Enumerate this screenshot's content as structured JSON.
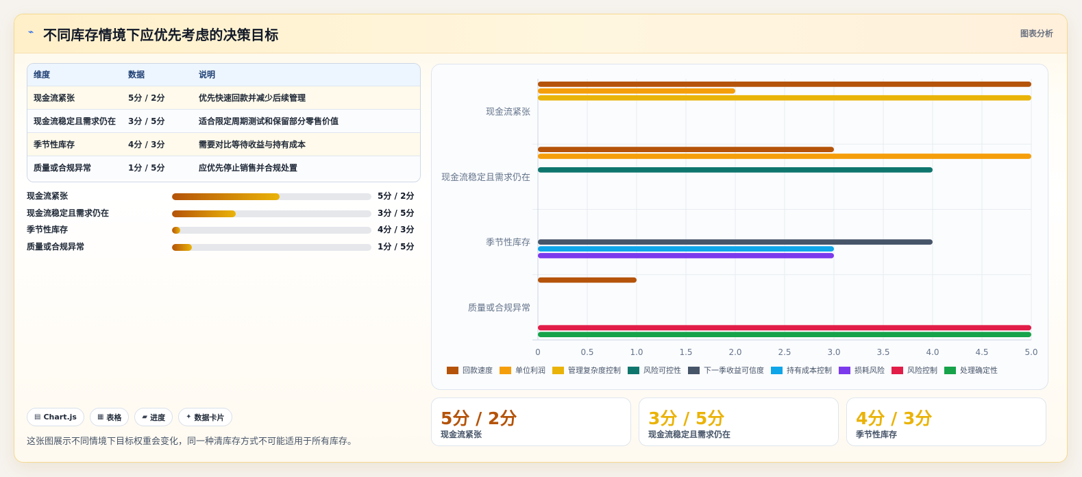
{
  "header": {
    "icon": "lightning-icon",
    "title": "不同库存情境下应优先考虑的决策目标",
    "right_label": "图表分析"
  },
  "table": {
    "headers": [
      "维度",
      "数据",
      "说明"
    ],
    "rows": [
      [
        "现金流紧张",
        "5分 / 2分",
        "优先快速回款并减少后续管理"
      ],
      [
        "现金流稳定且需求仍在",
        "3分 / 5分",
        "适合限定周期测试和保留部分零售价值"
      ],
      [
        "季节性库存",
        "4分 / 3分",
        "需要对比等待收益与持有成本"
      ],
      [
        "质量或合规异常",
        "1分 / 5分",
        "应优先停止销售并合规处置"
      ]
    ]
  },
  "progress": [
    {
      "label": "现金流紧张",
      "value_text": "5分 / 2分",
      "fill_fraction": 0.54
    },
    {
      "label": "现金流稳定且需求仍在",
      "value_text": "3分 / 5分",
      "fill_fraction": 0.32
    },
    {
      "label": "季节性库存",
      "value_text": "4分 / 3分",
      "fill_fraction": 0.04
    },
    {
      "label": "质量或合规异常",
      "value_text": "1分 / 5分",
      "fill_fraction": 0.1
    }
  ],
  "tags": [
    {
      "icon": "chart-icon",
      "label": "Chart.js",
      "glyph": "▤"
    },
    {
      "icon": "table-icon",
      "label": "表格",
      "glyph": "▦"
    },
    {
      "icon": "progress-icon",
      "label": "进度",
      "glyph": "▰"
    },
    {
      "icon": "card-icon",
      "label": "数据卡片",
      "glyph": "✦"
    }
  ],
  "footnote": "这张图展示不同情境下目标权重会变化，同一种清库存方式不可能适用于所有库存。",
  "stat_cards": [
    {
      "value": "5分 / 2分",
      "label": "现金流紧张",
      "color": "#b45309"
    },
    {
      "value": "3分 / 5分",
      "label": "现金流稳定且需求仍在",
      "color": "#eab308"
    },
    {
      "value": "4分 / 3分",
      "label": "季节性库存",
      "color": "#eab308"
    }
  ],
  "chart_data": {
    "type": "bar",
    "orientation": "horizontal",
    "categories": [
      "现金流紧张",
      "现金流稳定且需求仍在",
      "季节性库存",
      "质量或合规异常"
    ],
    "xlim": [
      0,
      5
    ],
    "xticks": [
      "0",
      "0.5",
      "1.0",
      "1.5",
      "2.0",
      "2.5",
      "3.0",
      "3.5",
      "4.0",
      "4.5",
      "5.0"
    ],
    "grid": true,
    "legend_position": "bottom",
    "series": [
      {
        "name": "回款速度",
        "color": "#b45309",
        "values": [
          5,
          3,
          null,
          1
        ]
      },
      {
        "name": "单位利润",
        "color": "#f59e0b",
        "values": [
          2,
          5,
          null,
          null
        ]
      },
      {
        "name": "管理复杂度控制",
        "color": "#eab308",
        "values": [
          5,
          null,
          null,
          null
        ]
      },
      {
        "name": "风险可控性",
        "color": "#0f766e",
        "values": [
          null,
          4,
          null,
          null
        ]
      },
      {
        "name": "下一季收益可信度",
        "color": "#475569",
        "values": [
          null,
          null,
          4,
          null
        ]
      },
      {
        "name": "持有成本控制",
        "color": "#0ea5e9",
        "values": [
          null,
          null,
          3,
          null
        ]
      },
      {
        "name": "损耗风险",
        "color": "#7c3aed",
        "values": [
          null,
          null,
          3,
          null
        ]
      },
      {
        "name": "风险控制",
        "color": "#e11d48",
        "values": [
          null,
          null,
          null,
          5
        ]
      },
      {
        "name": "处理确定性",
        "color": "#16a34a",
        "values": [
          null,
          null,
          null,
          5
        ]
      }
    ]
  }
}
